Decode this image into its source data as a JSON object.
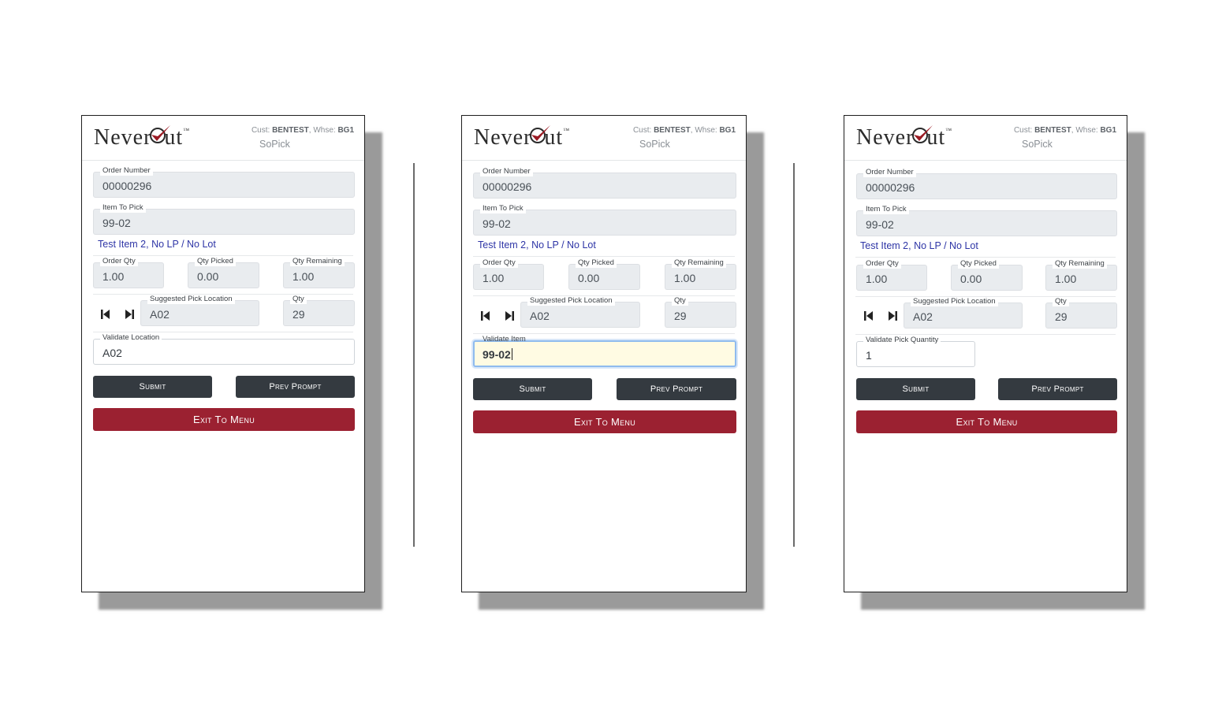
{
  "screens": [
    {
      "logo": {
        "text_before": "Never",
        "text_after": "ut",
        "tm": "™"
      },
      "header": {
        "cust_label": "Cust:",
        "cust": "BENTEST",
        "whse_label": "Whse:",
        "whse": "BG1",
        "app": "SoPick"
      },
      "order_number": {
        "label": "Order Number",
        "value": "00000296"
      },
      "item_to_pick": {
        "label": "Item To Pick",
        "value": "99-02"
      },
      "item_desc": "Test Item 2, No LP / No Lot",
      "order_qty": {
        "label": "Order Qty",
        "value": "1.00"
      },
      "qty_picked": {
        "label": "Qty Picked",
        "value": "0.00"
      },
      "qty_remaining": {
        "label": "Qty Remaining",
        "value": "1.00"
      },
      "suggested_location": {
        "label": "Suggested Pick Location",
        "value": "A02"
      },
      "location_qty": {
        "label": "Qty",
        "value": "29"
      },
      "validate": {
        "label": "Validate Location",
        "value": "A02"
      },
      "buttons": {
        "submit": "Submit",
        "prev": "Prev Prompt",
        "exit": "Exit To Menu"
      }
    },
    {
      "logo": {
        "text_before": "Never",
        "text_after": "ut",
        "tm": "™"
      },
      "header": {
        "cust_label": "Cust:",
        "cust": "BENTEST",
        "whse_label": "Whse:",
        "whse": "BG1",
        "app": "SoPick"
      },
      "order_number": {
        "label": "Order Number",
        "value": "00000296"
      },
      "item_to_pick": {
        "label": "Item To Pick",
        "value": "99-02"
      },
      "item_desc": "Test Item 2, No LP / No Lot",
      "order_qty": {
        "label": "Order Qty",
        "value": "1.00"
      },
      "qty_picked": {
        "label": "Qty Picked",
        "value": "0.00"
      },
      "qty_remaining": {
        "label": "Qty Remaining",
        "value": "1.00"
      },
      "suggested_location": {
        "label": "Suggested Pick Location",
        "value": "A02"
      },
      "location_qty": {
        "label": "Qty",
        "value": "29"
      },
      "validate": {
        "label": "Validate Item",
        "value": "99-02"
      },
      "buttons": {
        "submit": "Submit",
        "prev": "Prev Prompt",
        "exit": "Exit To Menu"
      }
    },
    {
      "logo": {
        "text_before": "Never",
        "text_after": "ut",
        "tm": "™"
      },
      "header": {
        "cust_label": "Cust:",
        "cust": "BENTEST",
        "whse_label": "Whse:",
        "whse": "BG1",
        "app": "SoPick"
      },
      "order_number": {
        "label": "Order Number",
        "value": "00000296"
      },
      "item_to_pick": {
        "label": "Item To Pick",
        "value": "99-02"
      },
      "item_desc": "Test Item 2, No LP / No Lot",
      "order_qty": {
        "label": "Order Qty",
        "value": "1.00"
      },
      "qty_picked": {
        "label": "Qty Picked",
        "value": "0.00"
      },
      "qty_remaining": {
        "label": "Qty Remaining",
        "value": "1.00"
      },
      "suggested_location": {
        "label": "Suggested Pick Location",
        "value": "A02"
      },
      "location_qty": {
        "label": "Qty",
        "value": "29"
      },
      "validate": {
        "label": "Validate Pick Quantity",
        "value": "1"
      },
      "buttons": {
        "submit": "Submit",
        "prev": "Prev Prompt",
        "exit": "Exit To Menu"
      }
    }
  ],
  "colors": {
    "logo_check": "#9b1b24",
    "exit_button": "#9b2131",
    "dark_button": "#343a40",
    "item_desc": "#2e35a6",
    "focus_field": "#fffbe3"
  },
  "icons": {
    "prev": "skip-back-icon",
    "next": "skip-forward-icon",
    "logo": "checkmark-icon"
  }
}
